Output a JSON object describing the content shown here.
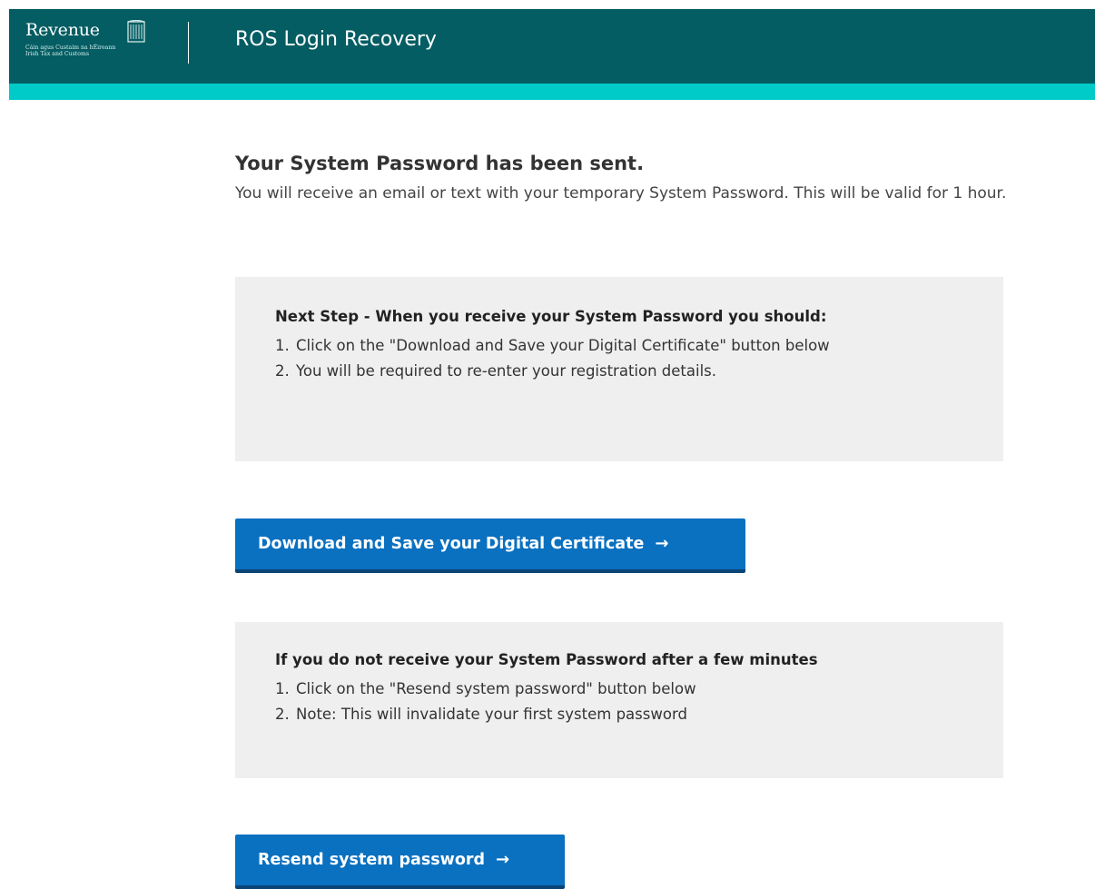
{
  "header": {
    "logo_text": "Revenue",
    "logo_subtitle_line1": "Cáin agus Custaim na hÉireann",
    "logo_subtitle_line2": "Irish Tax and Customs",
    "title": "ROS Login Recovery"
  },
  "main": {
    "heading": "Your System Password has been sent.",
    "intro": "You will receive an email or text with your temporary System Password. This will be valid for 1 hour."
  },
  "next_step_panel": {
    "title": "Next Step - When you receive your System Password you should:",
    "items": [
      {
        "num": "1.",
        "text": "Click on the \"Download and Save your Digital Certificate\" button below"
      },
      {
        "num": "2.",
        "text": "You will be required to re-enter your registration details."
      }
    ]
  },
  "download_button": {
    "label": "Download and Save your Digital Certificate",
    "icon": "arrow-right-icon"
  },
  "resend_panel": {
    "title": "If you do not receive your System Password after a few minutes",
    "items": [
      {
        "num": "1.",
        "text": "Click on the \"Resend system password\" button below"
      },
      {
        "num": "2.",
        "text": "Note: This will invalidate your first system password"
      }
    ]
  },
  "resend_button": {
    "label": "Resend system password",
    "icon": "arrow-right-icon"
  },
  "colors": {
    "header_bg": "#035d63",
    "header_stripe": "#00cbc9",
    "panel_bg": "#efeff0",
    "button_bg": "#0a70c0",
    "button_border": "#0a4476"
  }
}
